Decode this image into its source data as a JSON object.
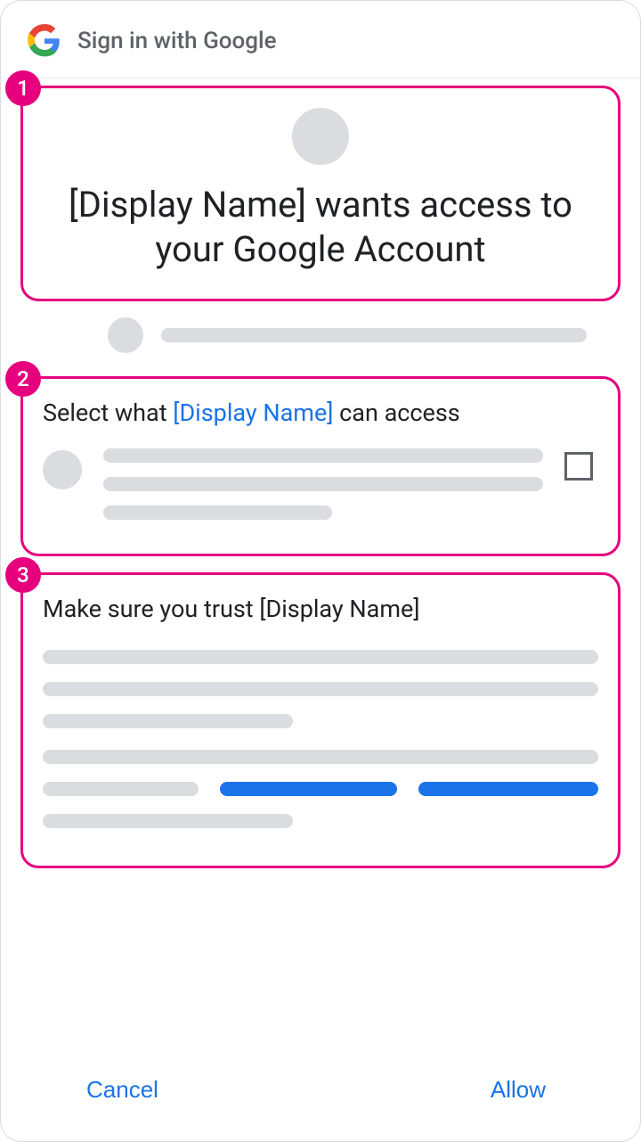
{
  "header": {
    "title": "Sign in with Google"
  },
  "annotations": {
    "badge1": "1",
    "badge2": "2",
    "badge3": "3"
  },
  "section1": {
    "title": "[Display Name] wants access to your Google Account"
  },
  "section2": {
    "title_prefix": "Select what ",
    "title_link": "[Display Name]",
    "title_suffix": " can access"
  },
  "section3": {
    "title": "Make sure you trust [Display Name]"
  },
  "footer": {
    "cancel": "Cancel",
    "allow": "Allow"
  }
}
